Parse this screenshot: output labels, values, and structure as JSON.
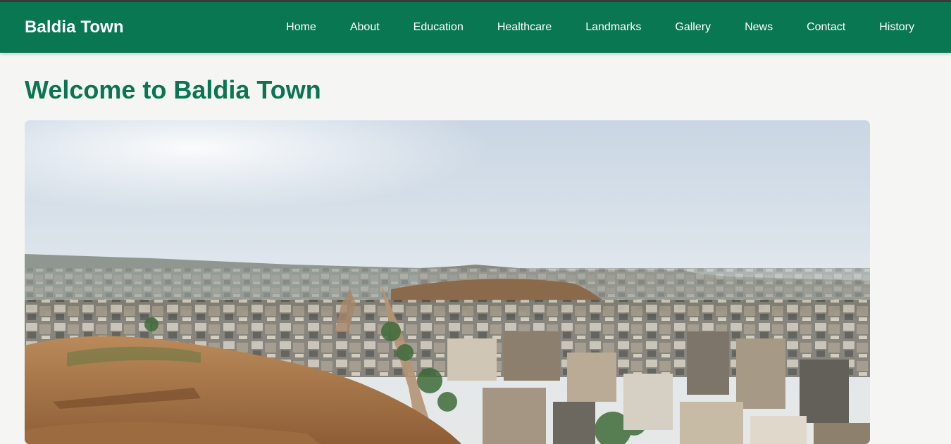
{
  "header": {
    "brand": "Baldia Town",
    "nav": [
      {
        "label": "Home"
      },
      {
        "label": "About"
      },
      {
        "label": "Education"
      },
      {
        "label": "Healthcare"
      },
      {
        "label": "Landmarks"
      },
      {
        "label": "Gallery"
      },
      {
        "label": "News"
      },
      {
        "label": "Contact"
      },
      {
        "label": "History"
      }
    ]
  },
  "main": {
    "title": "Welcome to Baldia Town"
  },
  "colors": {
    "header_bg": "#087752",
    "title": "#0a7453",
    "page_bg": "#f5f5f3"
  }
}
